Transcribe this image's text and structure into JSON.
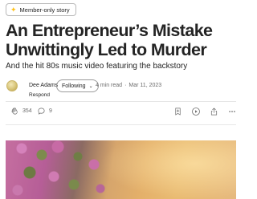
{
  "badge": {
    "icon": "star-icon",
    "label": "Member-only story",
    "star_color": "#ffc017"
  },
  "article": {
    "title": "An Entrepreneur’s Mistake Unwittingly Led to Murder",
    "subtitle": "And the hit 80s music video featuring the backstory"
  },
  "author": {
    "name": "Dee Adams",
    "follow_label": "Following",
    "respond_label": "Respond",
    "read_time": "4 min read",
    "separator": "·",
    "date": "Mar 11, 2023"
  },
  "actions": {
    "clap_icon": "clap-icon",
    "clap_count": "354",
    "comment_icon": "comment-icon",
    "comment_count": "9",
    "bookmark_icon": "bookmark-add-icon",
    "listen_icon": "play-icon",
    "share_icon": "share-icon",
    "more_icon": "more-icon"
  },
  "hero_image": {
    "name": "article-hero-image"
  }
}
